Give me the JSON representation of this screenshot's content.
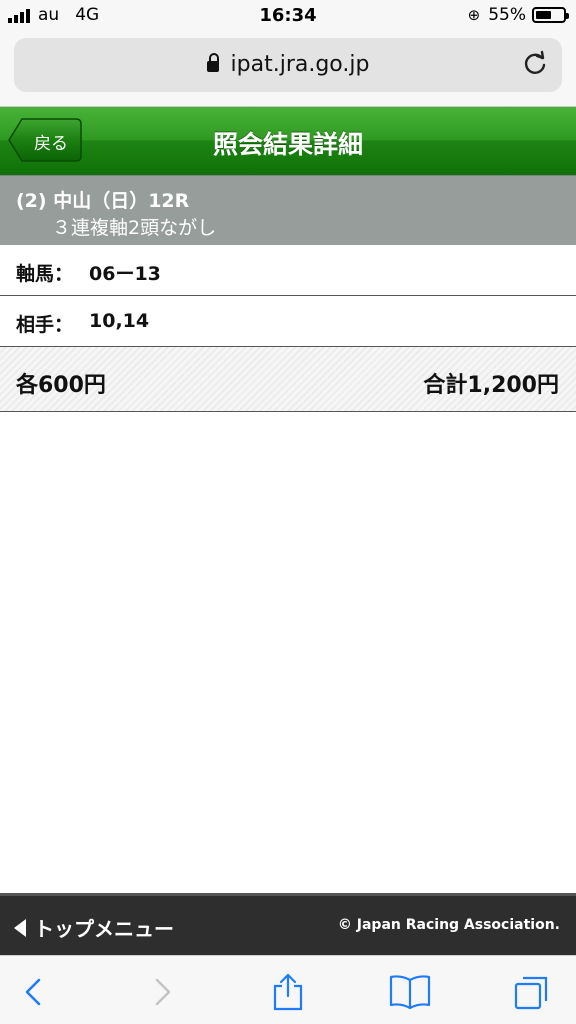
{
  "status_bar": {
    "carrier": "au",
    "network": "4G",
    "time": "16:34",
    "battery_percent": "55%"
  },
  "browser": {
    "url": "ipat.jra.go.jp"
  },
  "header": {
    "back_label": "戻る",
    "title": "照会結果詳細",
    "color": "#1e8414"
  },
  "race": {
    "line1": "(2) 中山（日）12R",
    "line2": "３連複軸2頭ながし"
  },
  "details": {
    "axis_label": "軸馬：",
    "axis_value": "06ー13",
    "partner_label": "相手：",
    "partner_value": "10,14"
  },
  "amounts": {
    "each": "各600円",
    "total": "合計1,200円"
  },
  "footer": {
    "top_menu_label": "トップメニュー",
    "copyright": "© Japan Racing Association."
  },
  "toolbar": {
    "accent_color": "#1f7cf6",
    "icons": [
      "back-icon",
      "forward-icon",
      "share-icon",
      "bookmarks-icon",
      "tabs-icon"
    ]
  }
}
